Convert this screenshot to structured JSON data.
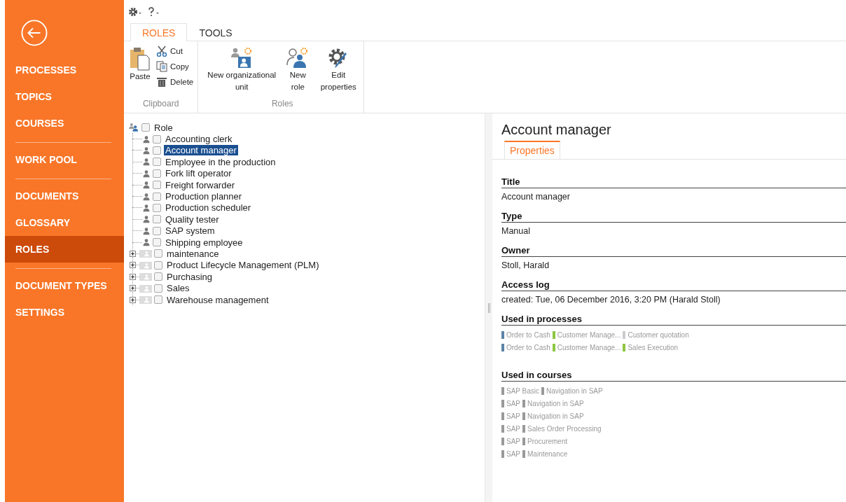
{
  "sidebar": {
    "groups": [
      [
        {
          "label": "PROCESSES",
          "selected": false
        },
        {
          "label": "TOPICS",
          "selected": false
        },
        {
          "label": "COURSES",
          "selected": false
        }
      ],
      [
        {
          "label": "WORK POOL",
          "selected": false
        }
      ],
      [
        {
          "label": "DOCUMENTS",
          "selected": false
        },
        {
          "label": "GLOSSARY",
          "selected": false
        },
        {
          "label": "ROLES",
          "selected": true
        }
      ],
      [
        {
          "label": "DOCUMENT TYPES",
          "selected": false
        },
        {
          "label": "SETTINGS",
          "selected": false
        }
      ]
    ]
  },
  "ribbon": {
    "tabs": [
      {
        "label": "ROLES",
        "selected": true
      },
      {
        "label": "TOOLS",
        "selected": false
      }
    ],
    "groups": [
      {
        "label": "Clipboard",
        "buttons": [
          {
            "label": "Paste",
            "kind": "paste"
          },
          {
            "label": "Cut",
            "kind": "cut"
          },
          {
            "label": "Copy",
            "kind": "copy"
          },
          {
            "label": "Delete",
            "kind": "delete"
          }
        ]
      },
      {
        "label": "Roles",
        "buttons": [
          {
            "label": "New organizational unit",
            "kind": "org-unit"
          },
          {
            "label": "New role",
            "kind": "new-role"
          },
          {
            "label": "Edit properties",
            "kind": "edit"
          }
        ]
      }
    ]
  },
  "tree": {
    "label": "Role",
    "checked": false,
    "children": [
      {
        "label": "Accounting clerk",
        "kind": "role",
        "checked": false,
        "selected": false
      },
      {
        "label": "Account manager",
        "kind": "role",
        "checked": false,
        "selected": true
      },
      {
        "label": "Employee in the production",
        "kind": "role",
        "checked": false,
        "selected": false
      },
      {
        "label": "Fork lift operator",
        "kind": "role",
        "checked": false,
        "selected": false
      },
      {
        "label": "Freight forwarder",
        "kind": "role",
        "checked": false,
        "selected": false
      },
      {
        "label": "Production planner",
        "kind": "role",
        "checked": false,
        "selected": false
      },
      {
        "label": "Production scheduler",
        "kind": "role",
        "checked": false,
        "selected": false
      },
      {
        "label": "Quality tester",
        "kind": "role",
        "checked": false,
        "selected": false
      },
      {
        "label": "SAP system",
        "kind": "role",
        "checked": false,
        "selected": false
      },
      {
        "label": "Shipping employee",
        "kind": "role",
        "checked": false,
        "selected": false
      },
      {
        "label": "maintenance",
        "kind": "group",
        "checked": false,
        "selected": false,
        "expanded": false
      },
      {
        "label": "Product Lifecycle Management (PLM)",
        "kind": "group",
        "checked": false,
        "selected": false,
        "expanded": false
      },
      {
        "label": "Purchasing",
        "kind": "group",
        "checked": false,
        "selected": false,
        "expanded": false
      },
      {
        "label": "Sales",
        "kind": "group",
        "checked": false,
        "selected": false,
        "expanded": false
      },
      {
        "label": "Warehouse management",
        "kind": "group",
        "checked": false,
        "selected": false,
        "expanded": false
      }
    ]
  },
  "detail": {
    "title": "Account manager",
    "tabs": [
      {
        "label": "Properties",
        "selected": true
      }
    ],
    "fields": [
      {
        "label": "Title",
        "value": "Account manager"
      },
      {
        "label": "Type",
        "value": "Manual"
      },
      {
        "label": "Owner",
        "value": "Stoll, Harald"
      },
      {
        "label": "Access log",
        "value": "created: Tue, 06 December 2016, 3:20 PM (Harald Stoll)"
      }
    ],
    "used_in_processes": {
      "label": "Used in processes",
      "rows": [
        [
          {
            "text": "Order to Cash",
            "color": "#5b84a8"
          },
          {
            "text": "Customer Manage...",
            "color": "#8cc63f"
          },
          {
            "text": "Customer quotation",
            "color": "#cccccc"
          }
        ],
        [
          {
            "text": "Order to Cash",
            "color": "#5b84a8"
          },
          {
            "text": "Customer Manage...",
            "color": "#8cc63f"
          },
          {
            "text": "Sales Execution",
            "color": "#8cc63f"
          }
        ]
      ]
    },
    "used_in_courses": {
      "label": "Used in courses",
      "rows": [
        [
          {
            "text": "SAP Basic",
            "color": "#999999"
          },
          {
            "text": "Navigation in SAP",
            "color": "#999999"
          }
        ],
        [
          {
            "text": "SAP",
            "color": "#999999"
          },
          {
            "text": "Navigation in SAP",
            "color": "#999999"
          }
        ],
        [
          {
            "text": "SAP",
            "color": "#999999"
          },
          {
            "text": "Navigation in SAP",
            "color": "#999999"
          }
        ],
        [
          {
            "text": "SAP",
            "color": "#999999"
          },
          {
            "text": "Sales Order Processing",
            "color": "#999999"
          }
        ],
        [
          {
            "text": "SAP",
            "color": "#999999"
          },
          {
            "text": "Procurement",
            "color": "#999999"
          }
        ],
        [
          {
            "text": "SAP",
            "color": "#999999"
          },
          {
            "text": "Maintenance",
            "color": "#999999"
          }
        ]
      ]
    }
  }
}
